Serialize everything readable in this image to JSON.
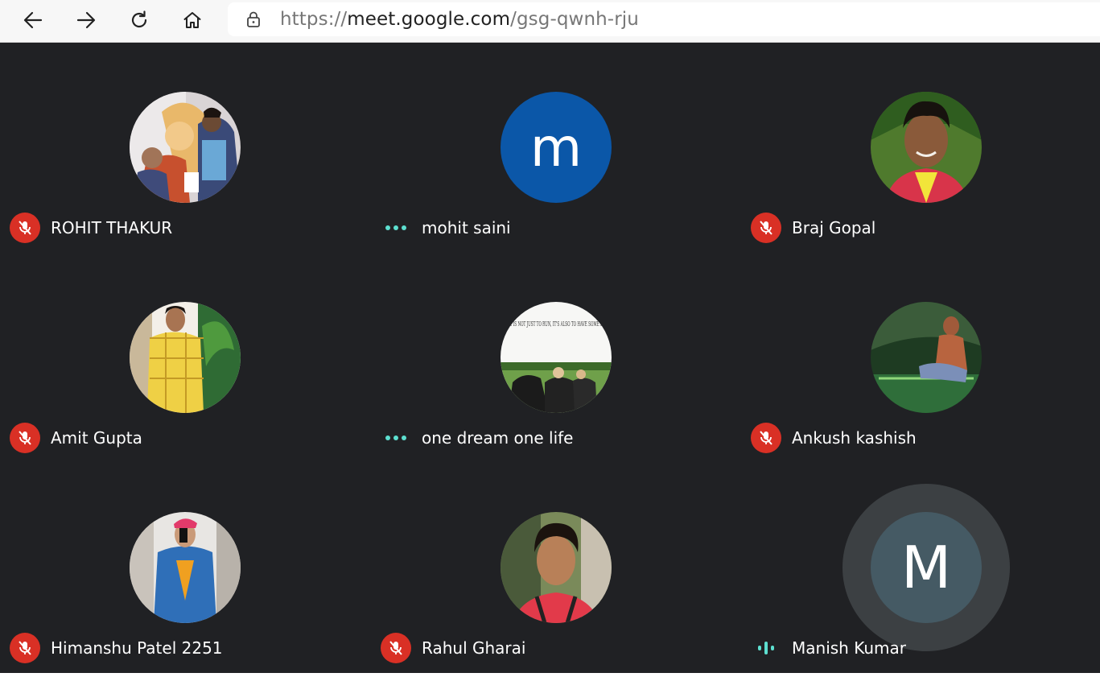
{
  "browser": {
    "back_icon": "arrow-left-icon",
    "forward_icon": "arrow-right-icon",
    "reload_icon": "reload-icon",
    "home_icon": "home-icon",
    "lock_icon": "lock-icon",
    "url_scheme": "https://",
    "url_host": "meet.google.com",
    "url_path": "/gsg-qwnh-rju"
  },
  "colors": {
    "stage_bg": "#202124",
    "muted_red": "#d93025",
    "speaking_teal": "#5ddfd0",
    "m_avatar_blue": "#0b57a8",
    "manish_avatar": "#455a64"
  },
  "participants": [
    {
      "name": "ROHIT THAKUR",
      "status": "muted",
      "avatar": "photo"
    },
    {
      "name": "mohit saini",
      "status": "connecting",
      "avatar": "letter",
      "letter": "m"
    },
    {
      "name": "Braj Gopal",
      "status": "muted",
      "avatar": "photo"
    },
    {
      "name": "Amit Gupta",
      "status": "muted",
      "avatar": "photo"
    },
    {
      "name": "one dream one life",
      "status": "connecting",
      "avatar": "photo"
    },
    {
      "name": "Ankush kashish",
      "status": "muted",
      "avatar": "photo"
    },
    {
      "name": "Himanshu Patel 2251",
      "status": "muted",
      "avatar": "photo"
    },
    {
      "name": "Rahul Gharai",
      "status": "muted",
      "avatar": "photo"
    },
    {
      "name": "Manish Kumar",
      "status": "speaking",
      "avatar": "letter",
      "letter": "M"
    }
  ],
  "photo_text": {
    "one_dream_caption": "LIFE IS NOT JUST TO RUN, IT'S ALSO TO HAVE SOME FUN"
  }
}
